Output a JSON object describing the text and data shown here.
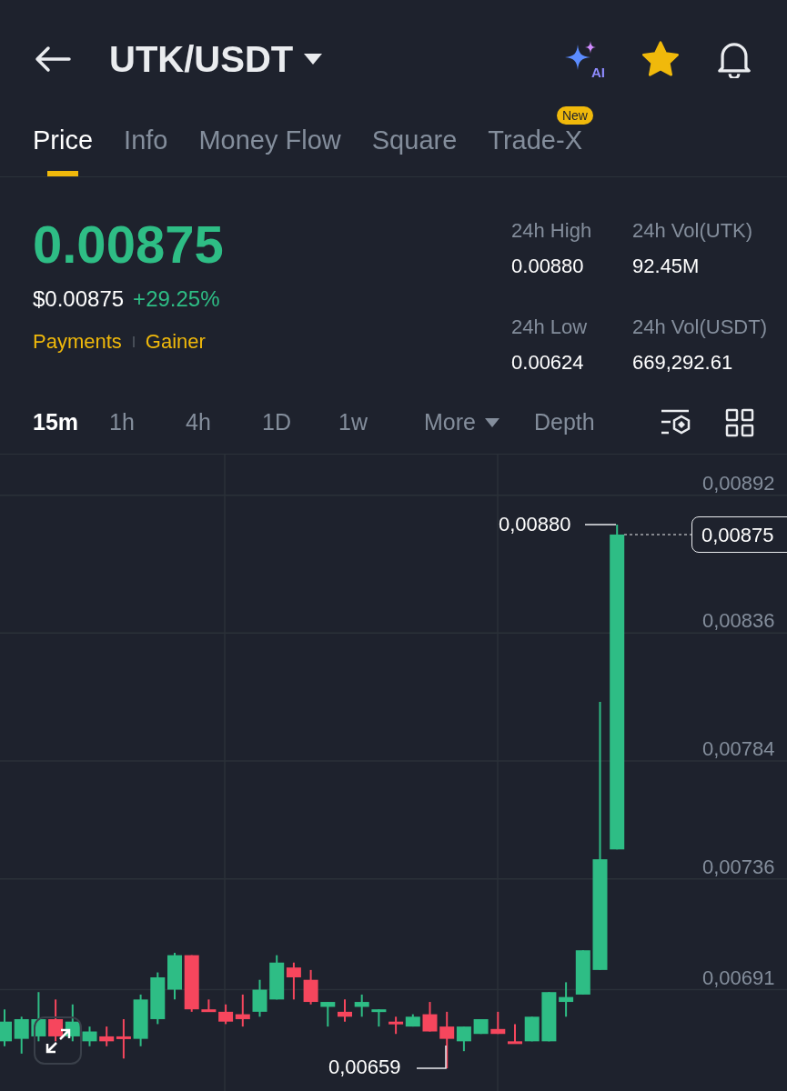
{
  "header": {
    "pair": "UTK/USDT",
    "ai_badge": "AI",
    "favorite": true
  },
  "tabs": [
    {
      "label": "Price",
      "selected": true
    },
    {
      "label": "Info",
      "selected": false
    },
    {
      "label": "Money Flow",
      "selected": false
    },
    {
      "label": "Square",
      "selected": false
    },
    {
      "label": "Trade-X",
      "selected": false,
      "badge": "New"
    }
  ],
  "ticker": {
    "last_price": "0.00875",
    "price_usd": "$0.00875",
    "change": "+29.25%",
    "tags": [
      "Payments",
      "Gainer"
    ]
  },
  "stats": [
    {
      "label": "24h High",
      "value": "0.00880"
    },
    {
      "label": "24h Vol(UTK)",
      "value": "92.45M"
    },
    {
      "label": "24h Low",
      "value": "0.00624"
    },
    {
      "label": "24h Vol(USDT)",
      "value": "669,292.61"
    }
  ],
  "intervals": [
    {
      "label": "15m",
      "selected": true
    },
    {
      "label": "1h",
      "selected": false
    },
    {
      "label": "4h",
      "selected": false
    },
    {
      "label": "1D",
      "selected": false
    },
    {
      "label": "1w",
      "selected": false
    }
  ],
  "more": "More",
  "depth": "Depth",
  "chart": {
    "last_price": "0,00875",
    "high": "0,00880",
    "low": "0,00659",
    "chart_data": {
      "type": "candlestick",
      "ylim": [
        0.006498,
        0.009085
      ],
      "grid": true,
      "yticks": [
        {
          "value": 0.00892,
          "label": "0,00892"
        },
        {
          "value": 0.00836,
          "label": "0,00836"
        },
        {
          "value": 0.00784,
          "label": "0,00784"
        },
        {
          "value": 0.00736,
          "label": "0,00736"
        },
        {
          "value": 0.00691,
          "label": "0,00691"
        }
      ],
      "ohlc": [
        [
          0.0067,
          0.00683,
          0.00668,
          0.00678
        ],
        [
          0.00671,
          0.0068,
          0.00665,
          0.00679
        ],
        [
          0.00672,
          0.0069,
          0.0067,
          0.00679
        ],
        [
          0.00679,
          0.00687,
          0.0067,
          0.00672
        ],
        [
          0.00672,
          0.00685,
          0.0067,
          0.00678
        ],
        [
          0.0067,
          0.00676,
          0.00668,
          0.00674
        ],
        [
          0.00672,
          0.00676,
          0.00668,
          0.0067
        ],
        [
          0.00672,
          0.00679,
          0.00663,
          0.00671
        ],
        [
          0.00671,
          0.00689,
          0.00668,
          0.00687
        ],
        [
          0.00679,
          0.00698,
          0.00677,
          0.00696
        ],
        [
          0.00691,
          0.00706,
          0.00687,
          0.00705
        ],
        [
          0.00705,
          0.00705,
          0.00682,
          0.00683
        ],
        [
          0.00683,
          0.00687,
          0.00682,
          0.00682
        ],
        [
          0.00682,
          0.00685,
          0.00677,
          0.00678
        ],
        [
          0.00681,
          0.00689,
          0.00676,
          0.00679
        ],
        [
          0.00682,
          0.00695,
          0.0068,
          0.00691
        ],
        [
          0.00687,
          0.00705,
          0.00687,
          0.00702
        ],
        [
          0.007,
          0.00702,
          0.00687,
          0.00696
        ],
        [
          0.00695,
          0.00699,
          0.00685,
          0.00686
        ],
        [
          0.00684,
          0.00686,
          0.00676,
          0.00686
        ],
        [
          0.00682,
          0.00687,
          0.00678,
          0.0068
        ],
        [
          0.00684,
          0.00689,
          0.0068,
          0.00686
        ],
        [
          0.00682,
          0.00683,
          0.00676,
          0.00683
        ],
        [
          0.00678,
          0.0068,
          0.00673,
          0.00677
        ],
        [
          0.00676,
          0.00681,
          0.00676,
          0.0068
        ],
        [
          0.00681,
          0.00686,
          0.00674,
          0.00674
        ],
        [
          0.00676,
          0.00682,
          0.00659,
          0.00671
        ],
        [
          0.0067,
          0.00676,
          0.00666,
          0.00676
        ],
        [
          0.00673,
          0.00679,
          0.00673,
          0.00679
        ],
        [
          0.00675,
          0.00682,
          0.00673,
          0.00673
        ],
        [
          0.0067,
          0.00677,
          0.00669,
          0.00669
        ],
        [
          0.0067,
          0.0068,
          0.0067,
          0.0068
        ],
        [
          0.0067,
          0.0069,
          0.0067,
          0.0069
        ],
        [
          0.00686,
          0.00694,
          0.0068,
          0.00688
        ],
        [
          0.00689,
          0.00707,
          0.00689,
          0.00707
        ],
        [
          0.00699,
          0.00808,
          0.00699,
          0.00744
        ],
        [
          0.00748,
          0.0088,
          0.00748,
          0.00876
        ]
      ]
    }
  }
}
